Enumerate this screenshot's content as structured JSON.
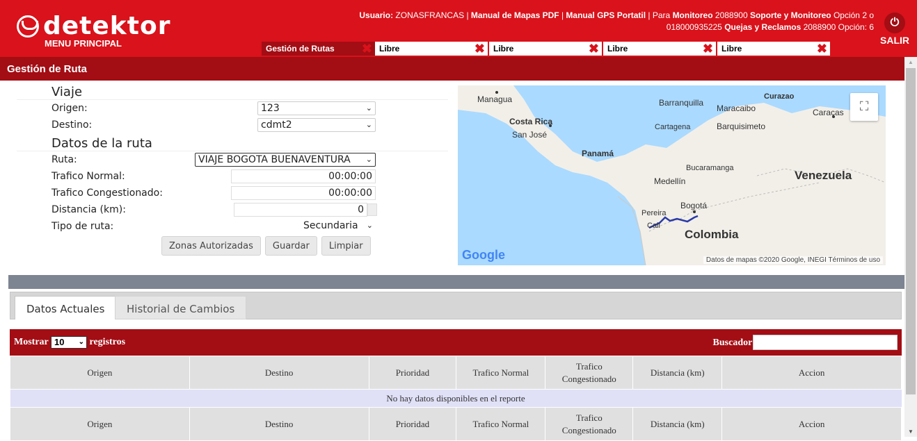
{
  "header": {
    "brand": "detektor",
    "menu_label": "MENU PRINCIPAL",
    "user_info": {
      "usuario_label": "Usuario:",
      "usuario": "ZONASFRANCAS",
      "sep1": " | ",
      "manual_mapas": "Manual de Mapas PDF",
      "sep2": " | ",
      "manual_gps": "Manual GPS Portatil",
      "sep3": " | Para ",
      "monitoreo_label": "Monitoreo",
      "monitoreo_num": " 2088900 ",
      "soporte_label": "Soporte y Monitoreo",
      "soporte_text": " Opción 2 o 018000935225 ",
      "quejas_label": "Quejas y Reclamos",
      "quejas_text": " 2088900 Opción: 6"
    },
    "salir": "SALIR",
    "power_icon": "⏻",
    "tabs": [
      {
        "label": "Gestión de Rutas",
        "active": true
      },
      {
        "label": "Libre"
      },
      {
        "label": "Libre"
      },
      {
        "label": "Libre"
      },
      {
        "label": "Libre"
      }
    ],
    "close_glyph": "✖"
  },
  "section_title": "Gestión de Ruta",
  "form": {
    "viaje_heading": "Viaje",
    "origen_label": "Origen:",
    "origen_value": "123",
    "destino_label": "Destino:",
    "destino_value": "cdmt2",
    "datos_heading": "Datos de la ruta",
    "ruta_label": "Ruta:",
    "ruta_value": "VIAJE BOGOTA BUENAVENTURA",
    "trafico_normal_label": "Trafico Normal:",
    "trafico_normal_value": "00:00:00",
    "trafico_cong_label": "Trafico Congestionado:",
    "trafico_cong_value": "00:00:00",
    "distancia_label": "Distancia (km):",
    "distancia_value": "0",
    "tipo_label": "Tipo de ruta:",
    "tipo_value": "Secundaria",
    "buttons": {
      "zonas": "Zonas Autorizadas",
      "guardar": "Guardar",
      "limpiar": "Limpiar"
    }
  },
  "map": {
    "labels": {
      "managua": "Managua",
      "costa_rica": "Costa Rica",
      "san_jose": "San José",
      "panama": "Panamá",
      "barranquilla": "Barranquilla",
      "cartagena": "Cartagena",
      "maracaibo": "Maracaibo",
      "curazao": "Curazao",
      "caracas": "Caracas",
      "barquisimeto": "Barquisimeto",
      "bucaramanga": "Bucaramanga",
      "venezuela": "Venezuela",
      "medellin": "Medellín",
      "pereira": "Pereira",
      "bogota": "Bogotá",
      "cali": "Cali",
      "colombia": "Colombia"
    },
    "google": "Google",
    "attribution": "Datos de mapas ©2020 Google, INEGI   Términos de uso",
    "fullscreen_icon": "⛶"
  },
  "tabs_panel": {
    "datos_actuales": "Datos Actuales",
    "historial": "Historial de Cambios"
  },
  "table": {
    "mostrar": "Mostrar",
    "page_size": "10",
    "registros": "registros",
    "buscador": "Buscador:",
    "columns": [
      "Origen",
      "Destino",
      "Prioridad",
      "Trafico Normal",
      "Trafico Congestionado",
      "Distancia (km)",
      "Accion"
    ],
    "empty_message": "No hay datos disponibles en el reporte"
  },
  "colors": {
    "header_red": "#d9121b",
    "dark_red": "#a30d14",
    "gray_bar": "#7d8492"
  }
}
